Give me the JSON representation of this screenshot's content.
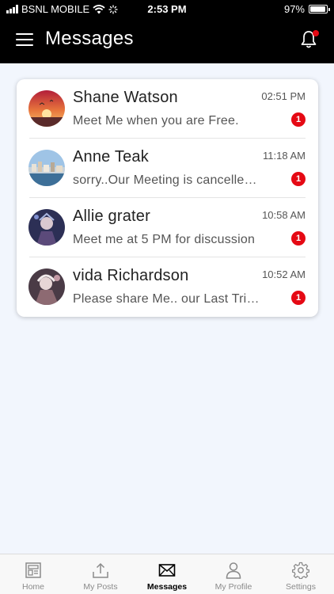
{
  "status_bar": {
    "carrier": "BSNL MOBILE",
    "time": "2:53 PM",
    "battery": "97%",
    "battery_level": 0.97,
    "icons": [
      "signal-icon",
      "wifi-icon",
      "loading-icon",
      "battery-icon"
    ]
  },
  "header": {
    "title": "Messages",
    "menu_icon": "hamburger-icon",
    "notification_icon": "bell-icon",
    "notification_dot_color": "#e50914"
  },
  "conversations": [
    {
      "name": "Shane Watson",
      "preview": "Meet Me when you are Free.",
      "time": "02:51 PM",
      "unread": "1"
    },
    {
      "name": "Anne Teak",
      "preview": "sorry..Our Meeting is cancelled today",
      "time": "11:18 AM",
      "unread": "1"
    },
    {
      "name": "Allie grater",
      "preview": "Meet me at 5 PM for discussion",
      "time": "10:58 AM",
      "unread": "1"
    },
    {
      "name": "vida Richardson",
      "preview": "Please share Me.. our Last Trip photos",
      "time": "10:52 AM",
      "unread": "1"
    }
  ],
  "tabs": [
    {
      "label": "Home",
      "icon": "home-icon",
      "active": false
    },
    {
      "label": "My Posts",
      "icon": "upload-icon",
      "active": false
    },
    {
      "label": "Messages",
      "icon": "envelope-icon",
      "active": true
    },
    {
      "label": "My Profile",
      "icon": "person-icon",
      "active": false
    },
    {
      "label": "Settings",
      "icon": "gear-icon",
      "active": false
    }
  ],
  "colors": {
    "header_bg": "#000000",
    "page_bg": "#f2f6fd",
    "badge": "#e50914"
  }
}
